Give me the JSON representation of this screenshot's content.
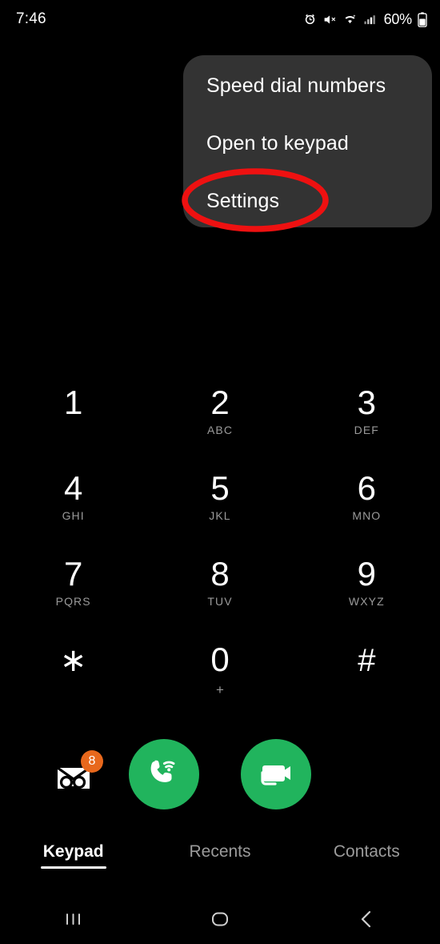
{
  "status_bar": {
    "time": "7:46",
    "battery_percent": "60%",
    "icons": [
      "alarm-icon",
      "mute-icon",
      "wifi-icon",
      "signal-icon",
      "battery-icon"
    ]
  },
  "popup_menu": {
    "items": [
      {
        "label": "Speed dial numbers"
      },
      {
        "label": "Open to keypad"
      },
      {
        "label": "Settings"
      }
    ],
    "background_color": "#333333"
  },
  "annotation": {
    "type": "ellipse",
    "color": "#ee1111",
    "target": "Settings"
  },
  "keypad": {
    "rows": [
      [
        {
          "digit": "1",
          "sub": ""
        },
        {
          "digit": "2",
          "sub": "ABC"
        },
        {
          "digit": "3",
          "sub": "DEF"
        }
      ],
      [
        {
          "digit": "4",
          "sub": "GHI"
        },
        {
          "digit": "5",
          "sub": "JKL"
        },
        {
          "digit": "6",
          "sub": "MNO"
        }
      ],
      [
        {
          "digit": "7",
          "sub": "PQRS"
        },
        {
          "digit": "8",
          "sub": "TUV"
        },
        {
          "digit": "9",
          "sub": "WXYZ"
        }
      ],
      [
        {
          "digit": "∗",
          "sub": ""
        },
        {
          "digit": "0",
          "sub": "+"
        },
        {
          "digit": "#",
          "sub": ""
        }
      ]
    ]
  },
  "actions": {
    "voicemail": {
      "icon": "voicemail-icon",
      "badge_count": "8",
      "badge_color": "#e8681c"
    },
    "call": {
      "icon": "wifi-call-icon",
      "color": "#21b45d"
    },
    "video_call": {
      "icon": "video-camera-icon",
      "color": "#21b45d"
    }
  },
  "tabs": [
    {
      "label": "Keypad",
      "active": true
    },
    {
      "label": "Recents",
      "active": false
    },
    {
      "label": "Contacts",
      "active": false
    }
  ],
  "nav_bar": {
    "recents": "recents-icon",
    "home": "home-icon",
    "back": "back-icon"
  }
}
